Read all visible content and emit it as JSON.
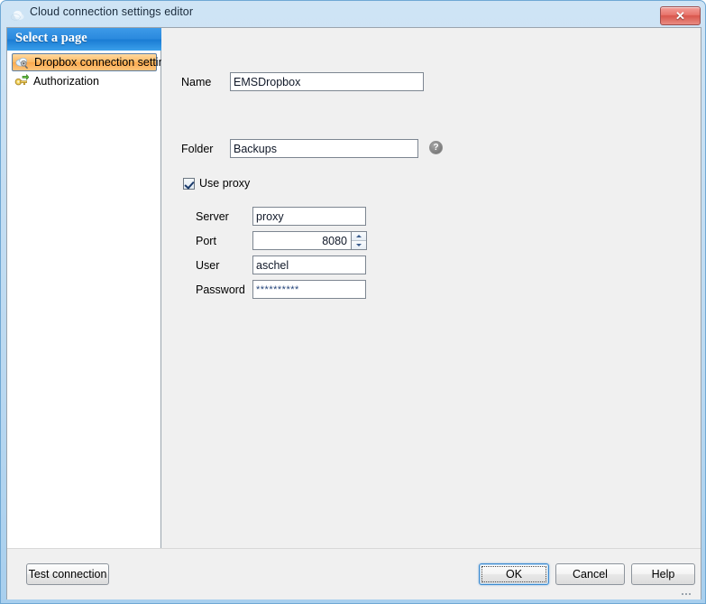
{
  "window": {
    "title": "Cloud connection settings editor",
    "title_icon": "cloud-icon",
    "close_label": "✕"
  },
  "sidebar": {
    "header": "Select a page",
    "items": [
      {
        "label": "Dropbox connection settings",
        "icon": "cloud-settings-icon",
        "selected": true
      },
      {
        "label": "Authorization",
        "icon": "key-icon",
        "selected": false
      }
    ]
  },
  "form": {
    "name": {
      "label": "Name",
      "value": "EMSDropbox"
    },
    "folder": {
      "label": "Folder",
      "value": "Backups",
      "help_icon": "help-icon",
      "help_glyph": "?"
    },
    "use_proxy": {
      "label": "Use proxy",
      "checked": true
    },
    "server": {
      "label": "Server",
      "value": "proxy"
    },
    "port": {
      "label": "Port",
      "value": "8080"
    },
    "user": {
      "label": "User",
      "value": "aschel"
    },
    "password": {
      "label": "Password",
      "value": "**********"
    }
  },
  "footer": {
    "test_connection": "Test connection",
    "ok": "OK",
    "cancel": "Cancel",
    "help": "Help"
  },
  "colors": {
    "accent_blue": "#2b8ade",
    "selected_orange": "#fcb862",
    "frame_blue": "#a8cfee",
    "close_red": "#d9564c"
  }
}
